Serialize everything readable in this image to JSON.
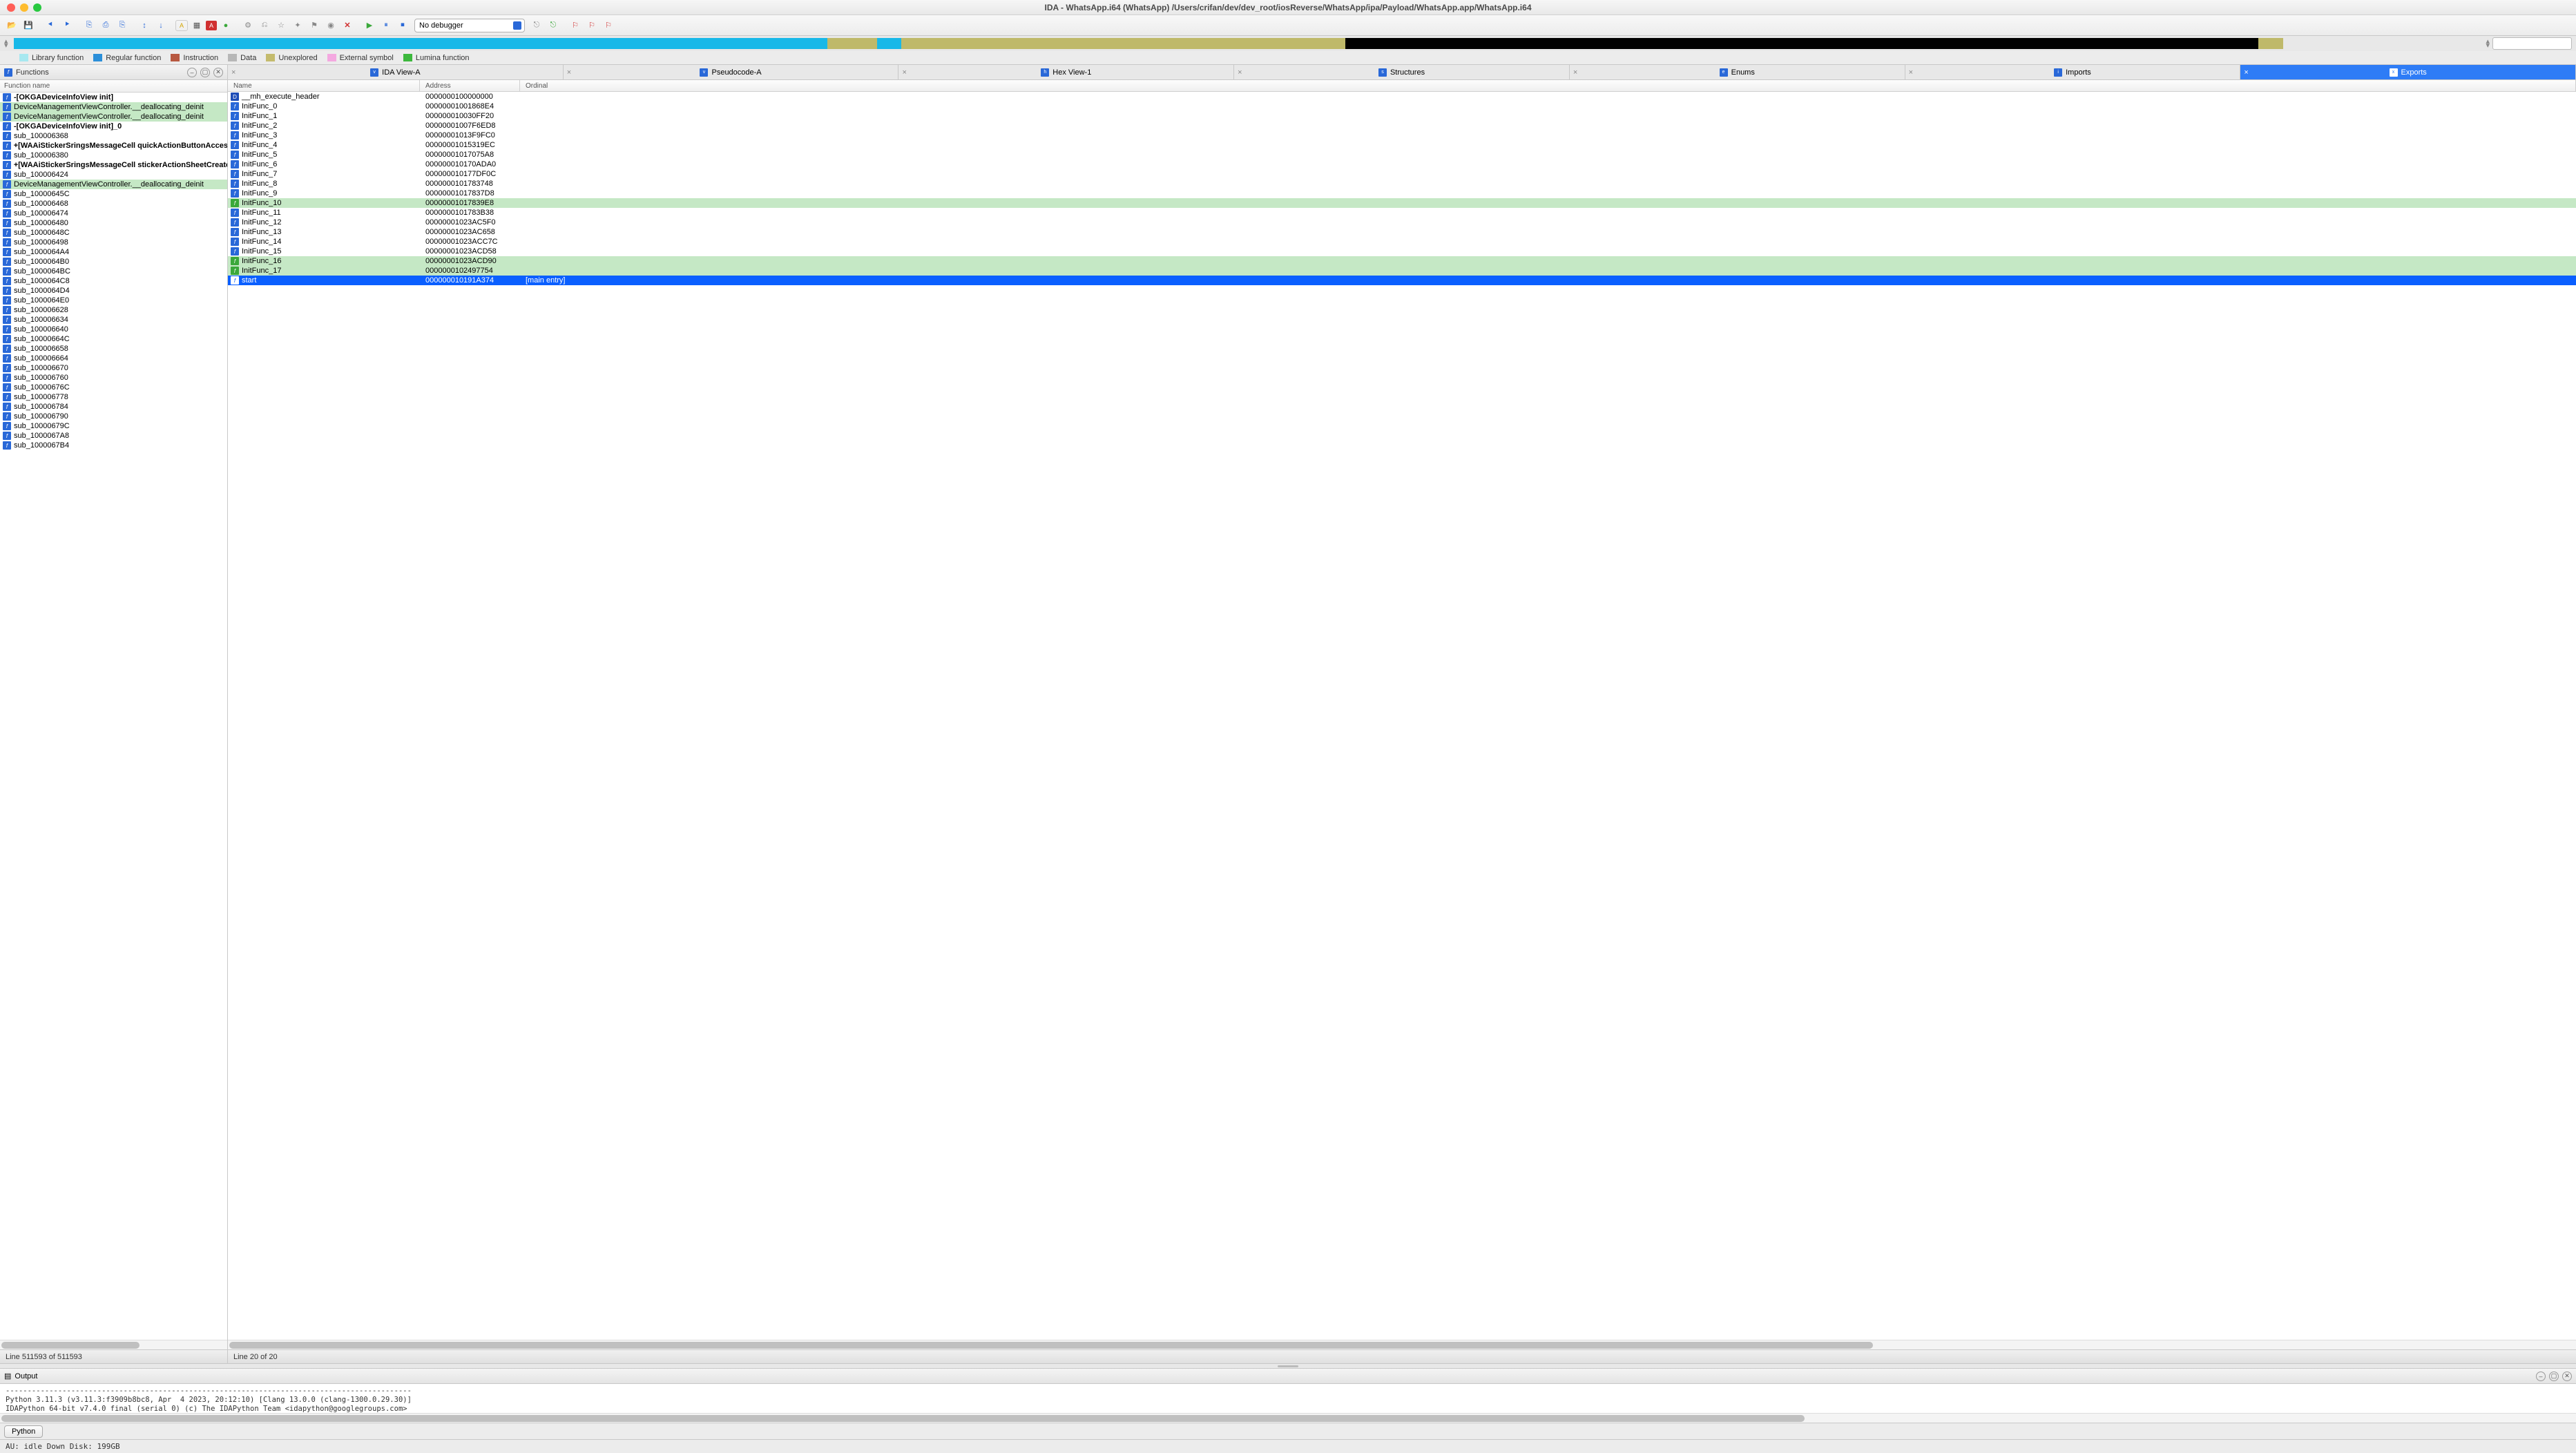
{
  "window_title": "IDA - WhatsApp.i64 (WhatsApp) /Users/crifan/dev/dev_root/iosReverse/WhatsApp/ipa/Payload/WhatsApp.app/WhatsApp.i64",
  "debugger_select": "No debugger",
  "legend": [
    {
      "color": "#a7e8f0",
      "label": "Library function"
    },
    {
      "color": "#2b8fd9",
      "label": "Regular function"
    },
    {
      "color": "#b85840",
      "label": "Instruction"
    },
    {
      "color": "#b7b7b7",
      "label": "Data"
    },
    {
      "color": "#c4bb6d",
      "label": "Unexplored"
    },
    {
      "color": "#f4a8e0",
      "label": "External symbol"
    },
    {
      "color": "#3db83d",
      "label": "Lumina function"
    }
  ],
  "overview_segments": [
    {
      "color": "#18b8e8",
      "pct": 33
    },
    {
      "color": "#bfb96a",
      "pct": 2
    },
    {
      "color": "#18b8e8",
      "pct": 1
    },
    {
      "color": "#bfb96a",
      "pct": 18
    },
    {
      "color": "#000000",
      "pct": 37
    },
    {
      "color": "#bfb96a",
      "pct": 1
    }
  ],
  "functions_panel": {
    "title": "Functions",
    "col": "Function name",
    "status": "Line 511593 of 511593",
    "items": [
      {
        "name": "-[OKGADeviceInfoView init]",
        "bold": true,
        "hl": false
      },
      {
        "name": "DeviceManagementViewController.__deallocating_deinit",
        "hl": true
      },
      {
        "name": "DeviceManagementViewController.__deallocating_deinit",
        "hl": true
      },
      {
        "name": "-[OKGADeviceInfoView init]_0",
        "bold": true
      },
      {
        "name": "sub_100006368"
      },
      {
        "name": "+[WAAiStickerSringsMessageCell quickActionButtonAccess",
        "bold": true
      },
      {
        "name": "sub_100006380"
      },
      {
        "name": "+[WAAiStickerSringsMessageCell stickerActionSheetCreate",
        "bold": true
      },
      {
        "name": "sub_100006424"
      },
      {
        "name": "DeviceManagementViewController.__deallocating_deinit",
        "hl": true
      },
      {
        "name": "sub_10000645C"
      },
      {
        "name": "sub_100006468"
      },
      {
        "name": "sub_100006474"
      },
      {
        "name": "sub_100006480"
      },
      {
        "name": "sub_10000648C"
      },
      {
        "name": "sub_100006498"
      },
      {
        "name": "sub_1000064A4"
      },
      {
        "name": "sub_1000064B0"
      },
      {
        "name": "sub_1000064BC"
      },
      {
        "name": "sub_1000064C8"
      },
      {
        "name": "sub_1000064D4"
      },
      {
        "name": "sub_1000064E0"
      },
      {
        "name": "sub_100006628"
      },
      {
        "name": "sub_100006634"
      },
      {
        "name": "sub_100006640"
      },
      {
        "name": "sub_10000664C"
      },
      {
        "name": "sub_100006658"
      },
      {
        "name": "sub_100006664"
      },
      {
        "name": "sub_100006670"
      },
      {
        "name": "sub_100006760"
      },
      {
        "name": "sub_10000676C"
      },
      {
        "name": "sub_100006778"
      },
      {
        "name": "sub_100006784"
      },
      {
        "name": "sub_100006790"
      },
      {
        "name": "sub_10000679C"
      },
      {
        "name": "sub_1000067A8"
      },
      {
        "name": "sub_1000067B4"
      }
    ]
  },
  "tabs": [
    {
      "label": "IDA View-A",
      "icon": "v"
    },
    {
      "label": "Pseudocode-A",
      "icon": "v"
    },
    {
      "label": "Hex View-1",
      "icon": "h"
    },
    {
      "label": "Structures",
      "icon": "s"
    },
    {
      "label": "Enums",
      "icon": "e"
    },
    {
      "label": "Imports",
      "icon": "i"
    },
    {
      "label": "Exports",
      "icon": "x",
      "active": true
    }
  ],
  "exports": {
    "cols": [
      "Name",
      "Address",
      "Ordinal"
    ],
    "status": "Line 20 of 20",
    "rows": [
      {
        "ic": "d",
        "name": "__mh_execute_header",
        "addr": "0000000100000000",
        "ord": ""
      },
      {
        "ic": "f",
        "name": "InitFunc_0",
        "addr": "00000001001868E4",
        "ord": ""
      },
      {
        "ic": "f",
        "name": "InitFunc_1",
        "addr": "000000010030FF20",
        "ord": ""
      },
      {
        "ic": "f",
        "name": "InitFunc_2",
        "addr": "00000001007F6ED8",
        "ord": ""
      },
      {
        "ic": "f",
        "name": "InitFunc_3",
        "addr": "00000001013F9FC0",
        "ord": ""
      },
      {
        "ic": "f",
        "name": "InitFunc_4",
        "addr": "00000001015319EC",
        "ord": ""
      },
      {
        "ic": "f",
        "name": "InitFunc_5",
        "addr": "00000001017075A8",
        "ord": ""
      },
      {
        "ic": "f",
        "name": "InitFunc_6",
        "addr": "000000010170ADA0",
        "ord": ""
      },
      {
        "ic": "f",
        "name": "InitFunc_7",
        "addr": "000000010177DF0C",
        "ord": ""
      },
      {
        "ic": "f",
        "name": "InitFunc_8",
        "addr": "0000000101783748",
        "ord": ""
      },
      {
        "ic": "f",
        "name": "InitFunc_9",
        "addr": "00000001017837D8",
        "ord": ""
      },
      {
        "ic": "fg",
        "name": "InitFunc_10",
        "addr": "00000001017839E8",
        "ord": "",
        "hl": true
      },
      {
        "ic": "f",
        "name": "InitFunc_11",
        "addr": "0000000101783B38",
        "ord": ""
      },
      {
        "ic": "f",
        "name": "InitFunc_12",
        "addr": "00000001023AC5F0",
        "ord": ""
      },
      {
        "ic": "f",
        "name": "InitFunc_13",
        "addr": "00000001023AC658",
        "ord": ""
      },
      {
        "ic": "f",
        "name": "InitFunc_14",
        "addr": "00000001023ACC7C",
        "ord": ""
      },
      {
        "ic": "f",
        "name": "InitFunc_15",
        "addr": "00000001023ACD58",
        "ord": ""
      },
      {
        "ic": "fg",
        "name": "InitFunc_16",
        "addr": "00000001023ACD90",
        "ord": "",
        "hl": true
      },
      {
        "ic": "fg",
        "name": "InitFunc_17",
        "addr": "0000000102497754",
        "ord": "",
        "hl": true
      },
      {
        "ic": "f",
        "name": "start",
        "addr": "000000010191A374",
        "ord": "[main entry]",
        "sel": true
      }
    ]
  },
  "output": {
    "title": "Output",
    "text": "---------------------------------------------------------------------------------------------\nPython 3.11.3 (v3.11.3:f3909b8bc8, Apr  4 2023, 20:12:10) [Clang 13.0.0 (clang-1300.0.29.30)]\nIDAPython 64-bit v7.4.0 final (serial 0) (c) The IDAPython Team <idapython@googlegroups.com>\n---------------------------------------------------------------------------------------------"
  },
  "python_button": "Python",
  "bottom_status": "AU:  idle   Down     Disk: 199GB"
}
